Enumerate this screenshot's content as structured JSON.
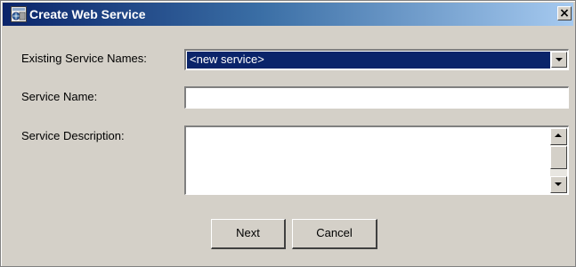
{
  "window": {
    "title": "Create Web Service",
    "close_glyph": "×",
    "title_icon": "web-service-icon"
  },
  "form": {
    "existing_label": "Existing Service Names:",
    "existing_value": "<new service>",
    "name_label": "Service Name:",
    "name_value": "",
    "description_label": "Service Description:",
    "description_value": ""
  },
  "buttons": {
    "next": "Next",
    "cancel": "Cancel"
  },
  "colors": {
    "title_start": "#0a246a",
    "title_end": "#a6caf0",
    "selection": "#0a246a",
    "face": "#d4d0c8"
  }
}
